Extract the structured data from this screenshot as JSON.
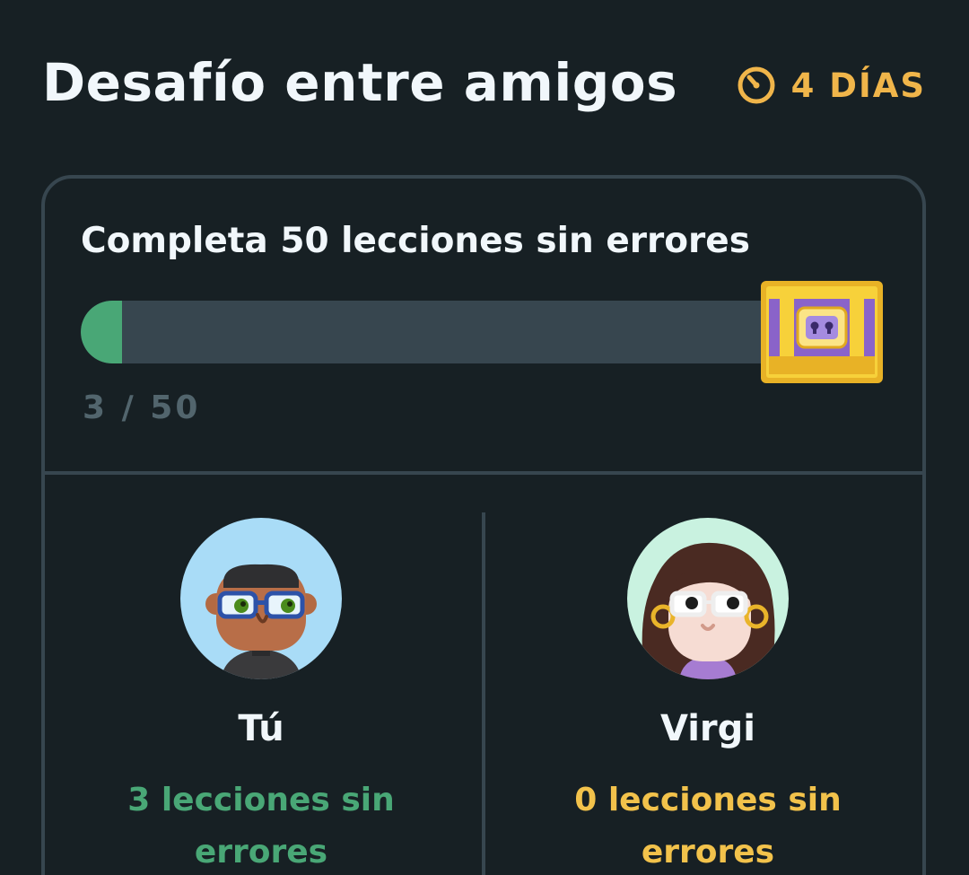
{
  "header": {
    "title": "Desafío entre amigos",
    "timer_label": "4 DÍAS",
    "timer_icon": "clock-icon",
    "timer_color": "#f0b54a"
  },
  "quest": {
    "title": "Completa 50 lecciones sin errores",
    "progress_text": "3 / 50",
    "progress_current": 3,
    "progress_total": 50,
    "reward_icon": "treasure-chest-icon",
    "fill_color": "#49a776",
    "track_color": "#37464f"
  },
  "players": [
    {
      "name": "Tú",
      "stat": "3 lecciones sin errores",
      "stat_color": "#49a776",
      "avatar_icon": "avatar-man-glasses-icon"
    },
    {
      "name": "Virgi",
      "stat": "0 lecciones sin errores",
      "stat_color": "#f2c24b",
      "avatar_icon": "avatar-woman-glasses-icon"
    }
  ]
}
